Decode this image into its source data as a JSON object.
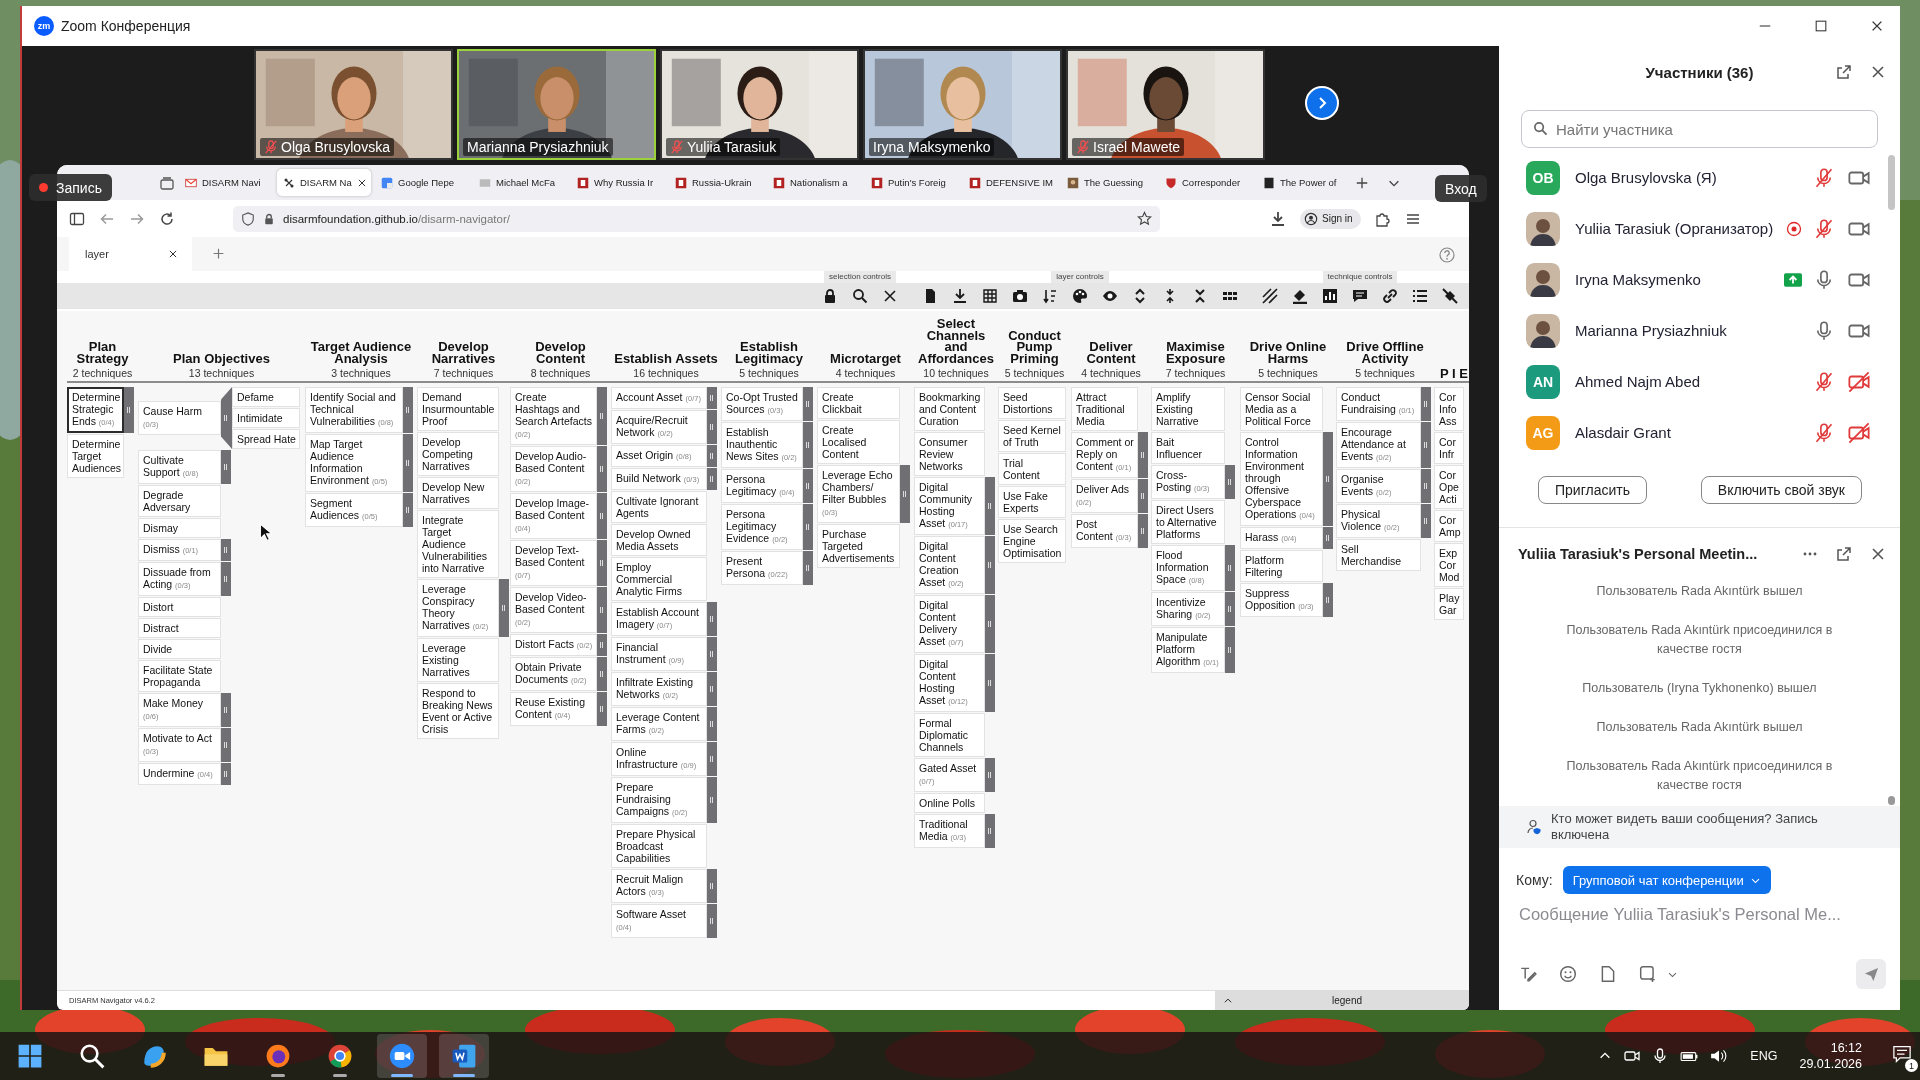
{
  "window": {
    "logo": "zm",
    "title": "Zoom Конференция"
  },
  "videos": [
    {
      "name": "Olga Brusylovska",
      "muted": true,
      "speaking": false
    },
    {
      "name": "Marianna Prysiazhniuk",
      "muted": false,
      "speaking": true
    },
    {
      "name": "Yuliia Tarasiuk",
      "muted": true,
      "speaking": false
    },
    {
      "name": "Iryna Maksymenko",
      "muted": false,
      "speaking": false
    },
    {
      "name": "Israel Mawete",
      "muted": true,
      "speaking": false
    }
  ],
  "recording": {
    "label": "Запись"
  },
  "share_toolbar": {
    "enter_label": "Вход"
  },
  "browser": {
    "tabs": [
      {
        "label": "DISARM Navi",
        "kind": "mail",
        "selected": false
      },
      {
        "label": "DISARM Na",
        "kind": "disarm",
        "selected": true
      },
      {
        "label": "Google Пере",
        "kind": "translate",
        "selected": false
      },
      {
        "label": "Michael McFa",
        "kind": "site",
        "selected": false
      },
      {
        "label": "Why Russia Ir",
        "kind": "journal",
        "selected": false
      },
      {
        "label": "Russia-Ukrain",
        "kind": "journal",
        "selected": false
      },
      {
        "label": "Nationalism a",
        "kind": "journal",
        "selected": false
      },
      {
        "label": "Putin's Foreig",
        "kind": "journal",
        "selected": false
      },
      {
        "label": "DEFENSIVE IM",
        "kind": "journal",
        "selected": false
      },
      {
        "label": "The Guessing",
        "selected": false
      },
      {
        "label": "Corresponder",
        "kind": "shield",
        "selected": false
      },
      {
        "label": "The Power of",
        "kind": "page",
        "selected": false
      }
    ],
    "url_host": "disarmfoundation.github.io",
    "url_path": "/disarm-navigator/",
    "sign_in": "Sign in"
  },
  "navigator": {
    "layer_tab": "layer",
    "toolbar_groups": [
      {
        "label": "selection controls"
      },
      {
        "label": "layer controls"
      },
      {
        "label": "technique controls"
      }
    ],
    "tactics": [
      {
        "name": "Plan Strategy",
        "count": "2 techniques",
        "techniques": [
          {
            "name": "Determine Strategic Ends",
            "count": "(0/4)",
            "expanded": false,
            "selected": true
          },
          {
            "name": "Determine Target Audiences",
            "selected": false
          }
        ]
      },
      {
        "name": "Plan Objectives",
        "count": "13 techniques",
        "techniques": [
          {
            "name": "Cause Harm",
            "count": "(0/3)",
            "expanded": true,
            "selected": false,
            "subtechniques": [
              {
                "name": "Defame",
                "selected": false
              },
              {
                "name": "Intimidate",
                "selected": false
              },
              {
                "name": "Spread Hate",
                "selected": false
              }
            ]
          },
          {
            "name": "Cultivate Support",
            "count": "(0/8)",
            "expanded": false,
            "selected": false
          },
          {
            "name": "Degrade Adversary",
            "selected": false
          },
          {
            "name": "Dismay",
            "selected": false
          },
          {
            "name": "Dismiss",
            "count": "(0/1)",
            "expanded": false,
            "selected": false
          },
          {
            "name": "Dissuade from Acting",
            "count": "(0/3)",
            "expanded": false,
            "selected": false
          },
          {
            "name": "Distort",
            "selected": false
          },
          {
            "name": "Distract",
            "selected": false
          },
          {
            "name": "Divide",
            "selected": false
          },
          {
            "name": "Facilitate State Propaganda",
            "selected": false
          },
          {
            "name": "Make Money",
            "count": "(0/6)",
            "expanded": false,
            "selected": false
          },
          {
            "name": "Motivate to Act",
            "count": "(0/3)",
            "expanded": false,
            "selected": false
          },
          {
            "name": "Undermine",
            "count": "(0/4)",
            "expanded": false,
            "selected": false
          }
        ]
      },
      {
        "name": "Target Audience Analysis",
        "count": "3 techniques",
        "techniques": [
          {
            "name": "Identify Social and Technical Vulnerabilities",
            "count": "(0/8)",
            "expanded": false,
            "selected": false
          },
          {
            "name": "Map Target Audience Information Environment",
            "count": "(0/5)",
            "expanded": false,
            "selected": false
          },
          {
            "name": "Segment Audiences",
            "count": "(0/5)",
            "expanded": false,
            "selected": false
          }
        ]
      },
      {
        "name": "Develop Narratives",
        "count": "7 techniques",
        "techniques": [
          {
            "name": "Demand Insurmountable Proof",
            "selected": false
          },
          {
            "name": "Develop Competing Narratives",
            "selected": false
          },
          {
            "name": "Develop New Narratives",
            "selected": false
          },
          {
            "name": "Integrate Target Audience Vulnerabilities into Narrative",
            "selected": false
          },
          {
            "name": "Leverage Conspiracy Theory Narratives",
            "count": "(0/2)",
            "expanded": false,
            "selected": false
          },
          {
            "name": "Leverage Existing Narratives",
            "selected": false
          },
          {
            "name": "Respond to Breaking News Event or Active Crisis",
            "selected": false
          }
        ]
      },
      {
        "name": "Develop Content",
        "count": "8 techniques",
        "techniques": [
          {
            "name": "Create Hashtags and Search Artefacts",
            "count": "(0/2)",
            "expanded": false,
            "selected": false
          },
          {
            "name": "Develop Audio-Based Content",
            "count": "(0/2)",
            "expanded": false,
            "selected": false
          },
          {
            "name": "Develop Image-Based Content",
            "count": "(0/4)",
            "expanded": false,
            "selected": false
          },
          {
            "name": "Develop Text-Based Content",
            "count": "(0/7)",
            "expanded": false,
            "selected": false
          },
          {
            "name": "Develop Video-Based Content",
            "count": "(0/2)",
            "expanded": false,
            "selected": false
          },
          {
            "name": "Distort Facts",
            "count": "(0/2)",
            "expanded": false,
            "selected": false
          },
          {
            "name": "Obtain Private Documents",
            "count": "(0/2)",
            "expanded": false,
            "selected": false
          },
          {
            "name": "Reuse Existing Content",
            "count": "(0/4)",
            "expanded": false,
            "selected": false
          }
        ]
      },
      {
        "name": "Establish Assets",
        "count": "16 techniques",
        "techniques": [
          {
            "name": "Account Asset",
            "count": "(0/7)",
            "expanded": false,
            "selected": false
          },
          {
            "name": "Acquire/Recruit Network",
            "count": "(0/2)",
            "expanded": false,
            "selected": false
          },
          {
            "name": "Asset Origin",
            "count": "(0/8)",
            "expanded": false,
            "selected": false
          },
          {
            "name": "Build Network",
            "count": "(0/3)",
            "expanded": false,
            "selected": false
          },
          {
            "name": "Cultivate Ignorant Agents",
            "selected": false
          },
          {
            "name": "Develop Owned Media Assets",
            "selected": false
          },
          {
            "name": "Employ Commercial Analytic Firms",
            "selected": false
          },
          {
            "name": "Establish Account Imagery",
            "count": "(0/7)",
            "expanded": false,
            "selected": false
          },
          {
            "name": "Financial Instrument",
            "count": "(0/9)",
            "expanded": false,
            "selected": false
          },
          {
            "name": "Infiltrate Existing Networks",
            "count": "(0/2)",
            "expanded": false,
            "selected": false
          },
          {
            "name": "Leverage Content Farms",
            "count": "(0/2)",
            "expanded": false,
            "selected": false
          },
          {
            "name": "Online Infrastructure",
            "count": "(0/9)",
            "expanded": false,
            "selected": false
          },
          {
            "name": "Prepare Fundraising Campaigns",
            "count": "(0/2)",
            "expanded": false,
            "selected": false
          },
          {
            "name": "Prepare Physical Broadcast Capabilities",
            "selected": false
          },
          {
            "name": "Recruit Malign Actors",
            "count": "(0/3)",
            "expanded": false,
            "selected": false
          },
          {
            "name": "Software Asset",
            "count": "(0/4)",
            "expanded": false,
            "selected": false
          }
        ]
      },
      {
        "name": "Establish Legitimacy",
        "count": "5 techniques",
        "techniques": [
          {
            "name": "Co-Opt Trusted Sources",
            "count": "(0/3)",
            "expanded": false,
            "selected": false
          },
          {
            "name": "Establish Inauthentic News Sites",
            "count": "(0/2)",
            "expanded": false,
            "selected": false
          },
          {
            "name": "Persona Legitimacy",
            "count": "(0/4)",
            "expanded": false,
            "selected": false
          },
          {
            "name": "Persona Legitimacy Evidence",
            "count": "(0/2)",
            "expanded": false,
            "selected": false
          },
          {
            "name": "Present Persona",
            "count": "(0/22)",
            "expanded": false,
            "selected": false
          }
        ]
      },
      {
        "name": "Microtarget",
        "count": "4 techniques",
        "techniques": [
          {
            "name": "Create Clickbait",
            "selected": false
          },
          {
            "name": "Create Localised Content",
            "selected": false
          },
          {
            "name": "Leverage Echo Chambers/ Filter Bubbles",
            "count": "(0/3)",
            "expanded": false,
            "selected": false
          },
          {
            "name": "Purchase Targeted Advertisements",
            "selected": false
          }
        ]
      },
      {
        "name": "Select Channels and Affordances",
        "count": "10 techniques",
        "techniques": [
          {
            "name": "Bookmarking and Content Curation",
            "selected": false
          },
          {
            "name": "Consumer Review Networks",
            "selected": false
          },
          {
            "name": "Digital Community Hosting Asset",
            "count": "(0/17)",
            "expanded": false,
            "selected": false
          },
          {
            "name": "Digital Content Creation Asset",
            "count": "(0/2)",
            "expanded": false,
            "selected": false
          },
          {
            "name": "Digital Content Delivery Asset",
            "count": "(0/7)",
            "expanded": false,
            "selected": false
          },
          {
            "name": "Digital Content Hosting Asset",
            "count": "(0/12)",
            "expanded": false,
            "selected": false
          },
          {
            "name": "Formal Diplomatic Channels",
            "selected": false
          },
          {
            "name": "Gated Asset",
            "count": "(0/7)",
            "expanded": false,
            "selected": false
          },
          {
            "name": "Online Polls",
            "selected": false
          },
          {
            "name": "Traditional Media",
            "count": "(0/3)",
            "expanded": false,
            "selected": false
          }
        ]
      },
      {
        "name": "Conduct Pump Priming",
        "count": "5 techniques",
        "techniques": [
          {
            "name": "Seed Distortions",
            "selected": false
          },
          {
            "name": "Seed Kernel of Truth",
            "selected": false
          },
          {
            "name": "Trial Content",
            "selected": false
          },
          {
            "name": "Use Fake Experts",
            "selected": false
          },
          {
            "name": "Use Search Engine Optimisation",
            "selected": false
          }
        ]
      },
      {
        "name": "Deliver Content",
        "count": "4 techniques",
        "techniques": [
          {
            "name": "Attract Traditional Media",
            "selected": false
          },
          {
            "name": "Comment or Reply on Content",
            "count": "(0/1)",
            "expanded": false,
            "selected": false
          },
          {
            "name": "Deliver Ads",
            "count": "(0/2)",
            "expanded": false,
            "selected": false
          },
          {
            "name": "Post Content",
            "count": "(0/3)",
            "expanded": false,
            "selected": false
          }
        ]
      },
      {
        "name": "Maximise Exposure",
        "count": "7 techniques",
        "techniques": [
          {
            "name": "Amplify Existing Narrative",
            "selected": false
          },
          {
            "name": "Bait Influencer",
            "selected": false
          },
          {
            "name": "Cross-Posting",
            "count": "(0/3)",
            "expanded": false,
            "selected": false
          },
          {
            "name": "Direct Users to Alternative Platforms",
            "selected": false
          },
          {
            "name": "Flood Information Space",
            "count": "(0/8)",
            "expanded": false,
            "selected": false
          },
          {
            "name": "Incentivize Sharing",
            "count": "(0/2)",
            "expanded": false,
            "selected": false
          },
          {
            "name": "Manipulate Platform Algorithm",
            "count": "(0/1)",
            "expanded": false,
            "selected": false
          }
        ]
      },
      {
        "name": "Drive Online Harms",
        "count": "5 techniques",
        "techniques": [
          {
            "name": "Censor Social Media as a Political Force",
            "selected": false
          },
          {
            "name": "Control Information Environment through Offensive Cyberspace Operations",
            "count": "(0/4)",
            "expanded": false,
            "selected": false
          },
          {
            "name": "Harass",
            "count": "(0/4)",
            "expanded": false,
            "selected": false
          },
          {
            "name": "Platform Filtering",
            "selected": false
          },
          {
            "name": "Suppress Opposition",
            "count": "(0/3)",
            "expanded": false,
            "selected": false
          }
        ]
      },
      {
        "name": "Drive Offline Activity",
        "count": "5 techniques",
        "techniques": [
          {
            "name": "Conduct Fundraising",
            "count": "(0/1)",
            "expanded": false,
            "selected": false
          },
          {
            "name": "Encourage Attendance at Events",
            "count": "(0/2)",
            "expanded": false,
            "selected": false
          },
          {
            "name": "Organise Events",
            "count": "(0/2)",
            "expanded": false,
            "selected": false
          },
          {
            "name": "Physical Violence",
            "count": "(0/2)",
            "expanded": false,
            "selected": false
          },
          {
            "name": "Sell Merchandise",
            "selected": false
          }
        ]
      },
      {
        "name": "P I E",
        "techniques": [
          {
            "name": "Cor Info Ass",
            "selected": false
          },
          {
            "name": "Cor Infr",
            "selected": false
          },
          {
            "name": "Cor Ope Acti",
            "selected": false
          },
          {
            "name": "Cor Amp",
            "selected": false
          },
          {
            "name": "Exp Cor Mod",
            "selected": false
          },
          {
            "name": "Play Gar",
            "selected": false
          }
        ]
      }
    ],
    "version": "DISARM Navigator v4.6.2",
    "legend": "legend"
  },
  "participants": {
    "title": "Участники (36)",
    "search_placeholder": "Найти участника",
    "list": [
      {
        "name": "Olga Brusylovska (Я)",
        "avatar": {
          "kind": "initials",
          "initials": "OB",
          "color": "#27a85a"
        },
        "recording": false,
        "sharing": false,
        "mic_muted": true,
        "video_on": true
      },
      {
        "name": "Yuliia Tarasiuk (Организатор)",
        "recording": true,
        "sharing": false,
        "mic_muted": true,
        "video_on": true
      },
      {
        "name": "Iryna Maksymenko",
        "recording": false,
        "sharing": true,
        "mic_muted": false,
        "video_on": true
      },
      {
        "name": "Marianna Prysiazhniuk",
        "recording": false,
        "sharing": false,
        "mic_muted": false,
        "video_on": true
      },
      {
        "name": "Ahmed Najm Abed",
        "avatar": {
          "kind": "initials",
          "initials": "AN",
          "color": "#1b9a7e"
        },
        "recording": false,
        "sharing": false,
        "mic_muted": true,
        "video_on": false
      },
      {
        "name": "Alasdair Grant",
        "avatar": {
          "kind": "initials",
          "initials": "AG",
          "color": "#f39a16"
        },
        "recording": false,
        "sharing": false,
        "mic_muted": true,
        "video_on": false
      }
    ],
    "invite": "Пригласить",
    "unmute": "Включить свой звук"
  },
  "chat": {
    "title": "Yuliia Tarasiuk's Personal Meetin...",
    "messages": [
      "Пользователь Rada Akıntürk вышел",
      "Пользователь Rada Akıntürk присоединился в качестве гостя",
      "Пользователь (Iryna Tykhonenko) вышел",
      "Пользователь Rada Akıntürk вышел",
      "Пользователь Rada Akıntürk присоединился в качестве гостя"
    ],
    "notice": "Кто может видеть ваши сообщения? Запись включена",
    "to_label": "Кому:",
    "recipient": "Групповой чат конференции",
    "placeholder": "Сообщение Yuliia Tarasiuk's Personal Me..."
  },
  "taskbar": {
    "apps": [
      {
        "kind": "start",
        "running": false,
        "active": false
      },
      {
        "kind": "search",
        "running": false,
        "active": false
      },
      {
        "kind": "copilot",
        "running": false,
        "active": false
      },
      {
        "kind": "files",
        "running": false,
        "active": false
      },
      {
        "kind": "firefox",
        "running": true,
        "active": false
      },
      {
        "kind": "chrome",
        "running": true,
        "active": false
      },
      {
        "kind": "zoom",
        "running": true,
        "active": true
      },
      {
        "kind": "word",
        "running": true,
        "active": true
      }
    ],
    "language": "ENG",
    "time": "16:12",
    "date": "29.01.2026",
    "notifications": "1"
  }
}
